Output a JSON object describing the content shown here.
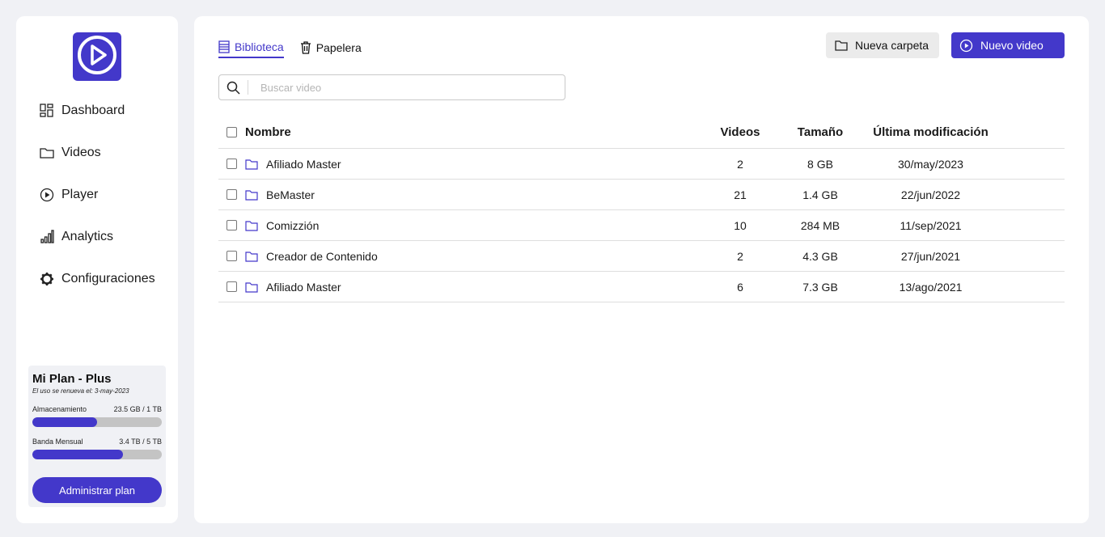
{
  "colors": {
    "accent": "#4338ca",
    "background": "#f0f1f5"
  },
  "logo": {
    "icon": "play-circle-icon"
  },
  "nav": [
    {
      "label": "Dashboard",
      "icon": "grid-icon"
    },
    {
      "label": "Videos",
      "icon": "folder-icon"
    },
    {
      "label": "Player",
      "icon": "play-circle-icon"
    },
    {
      "label": "Analytics",
      "icon": "bar-chart-icon"
    },
    {
      "label": "Configuraciones",
      "icon": "gear-icon"
    }
  ],
  "plan": {
    "title": "Mi Plan - Plus",
    "renewal": "El uso se renueva el: 3-may-2023",
    "storage": {
      "label": "Almacenamiento",
      "value": "23.5 GB / 1 TB",
      "fill_percent": 50
    },
    "bandwidth": {
      "label": "Banda Mensual",
      "value": "3.4 TB / 5 TB",
      "fill_percent": 70
    },
    "button": "Administrar plan"
  },
  "tabs": [
    {
      "label": "Biblioteca",
      "icon": "library-icon",
      "active": true
    },
    {
      "label": "Papelera",
      "icon": "trash-icon",
      "active": false
    }
  ],
  "actions": {
    "new_folder": "Nueva carpeta",
    "new_video": "Nuevo video"
  },
  "search": {
    "placeholder": "Buscar video",
    "value": ""
  },
  "table": {
    "headers": {
      "name": "Nombre",
      "videos": "Videos",
      "size": "Tamaño",
      "modified": "Última modificación"
    },
    "rows": [
      {
        "name": "Afiliado Master",
        "videos": "2",
        "size": "8 GB",
        "modified": "30/may/2023"
      },
      {
        "name": "BeMaster",
        "videos": "21",
        "size": "1.4 GB",
        "modified": "22/jun/2022"
      },
      {
        "name": "Comizzión",
        "videos": "10",
        "size": "284 MB",
        "modified": "11/sep/2021"
      },
      {
        "name": "Creador de Contenido",
        "videos": "2",
        "size": "4.3 GB",
        "modified": "27/jun/2021"
      },
      {
        "name": "Afiliado Master",
        "videos": "6",
        "size": "7.3 GB",
        "modified": "13/ago/2021"
      }
    ]
  }
}
